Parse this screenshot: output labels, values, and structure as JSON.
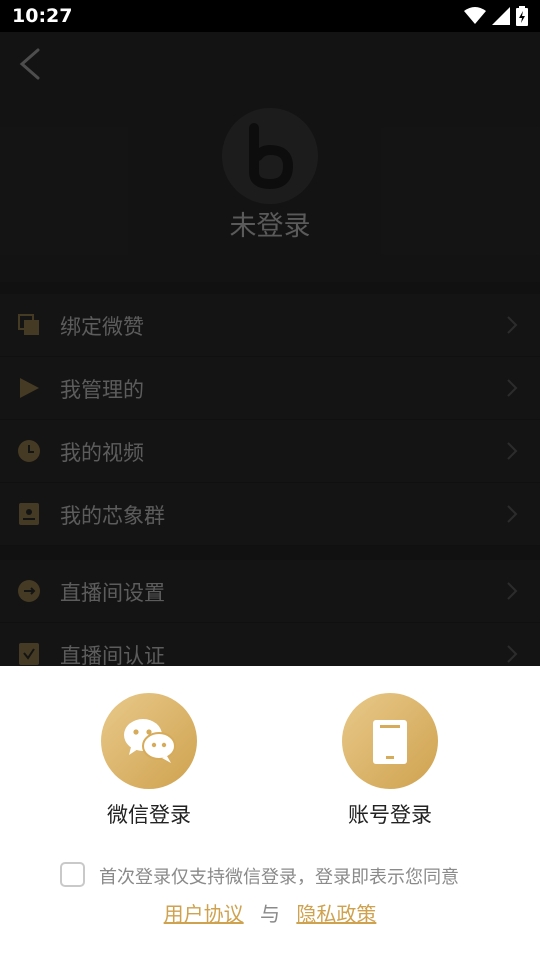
{
  "status_bar": {
    "time": "10:27"
  },
  "header": {
    "login_state": "未登录"
  },
  "menu": {
    "group1": [
      {
        "label": "绑定微赞",
        "icon": "bind-icon"
      },
      {
        "label": "我管理的",
        "icon": "play-icon"
      },
      {
        "label": "我的视频",
        "icon": "clock-icon"
      },
      {
        "label": "我的芯象群",
        "icon": "group-icon"
      }
    ],
    "group2": [
      {
        "label": "直播间设置",
        "icon": "settings-icon"
      },
      {
        "label": "直播间认证",
        "icon": "certify-icon"
      }
    ]
  },
  "login_sheet": {
    "wechat_label": "微信登录",
    "account_label": "账号登录",
    "agreement_text": "首次登录仅支持微信登录，登录即表示您同意",
    "user_agreement": "用户协议",
    "and": "与",
    "privacy_policy": "隐私政策"
  },
  "colors": {
    "gold": "#cfa24f",
    "gold_light": "#e8c98a",
    "dark_bg": "#1b1b1b"
  }
}
